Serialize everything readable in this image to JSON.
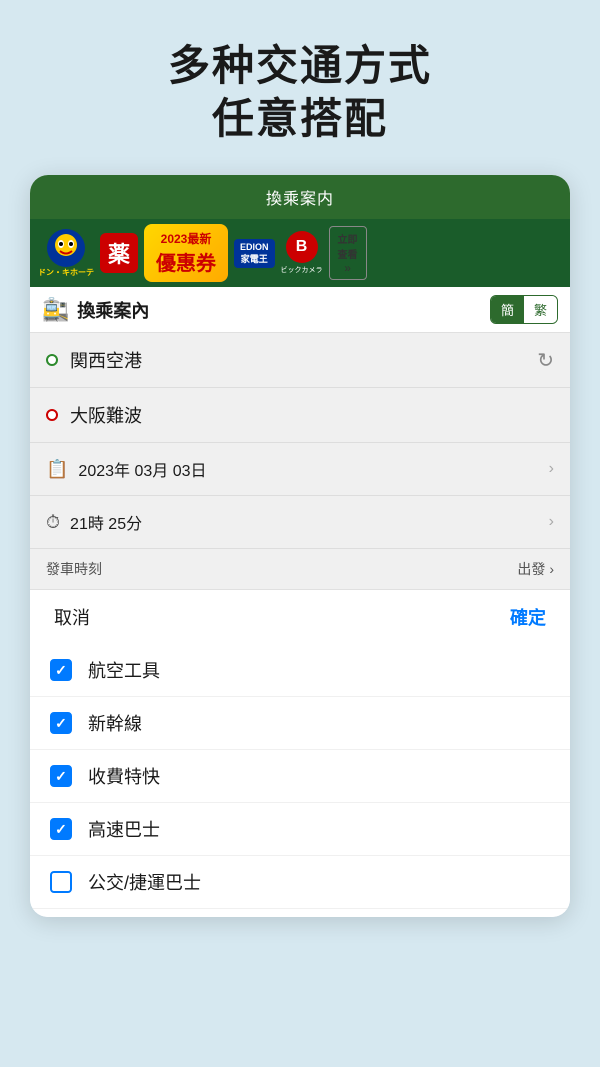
{
  "hero": {
    "line1": "多种交通方式",
    "line2": "任意搭配"
  },
  "card": {
    "header": "換乘案内",
    "nav_title": "換乘案內",
    "lang_simple": "簡",
    "lang_trad": "繁",
    "from_label": "関西空港",
    "to_label": "大阪難波",
    "date_icon": "📅",
    "date_value": "2023年 03月 03日",
    "time_icon": "⏱",
    "time_value": "21時 25分",
    "depart_label": "發車時刻",
    "depart_value": "出發",
    "cancel_label": "取消",
    "confirm_label": "確定",
    "transport_items": [
      {
        "label": "航空工具",
        "checked": true
      },
      {
        "label": "新幹線",
        "checked": true
      },
      {
        "label": "收費特快",
        "checked": true
      },
      {
        "label": "高速巴士",
        "checked": true
      },
      {
        "label": "公交/捷運巴士",
        "checked": false
      }
    ]
  }
}
